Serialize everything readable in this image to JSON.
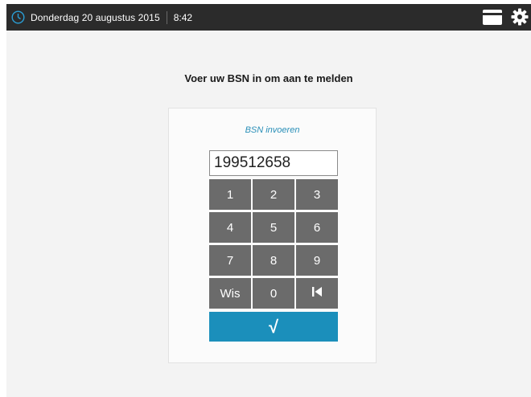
{
  "topbar": {
    "date": "Donderdag 20 augustus 2015",
    "time": "8:42",
    "icons": [
      "clock-icon",
      "card-icon",
      "gear-icon"
    ]
  },
  "prompt": "Voer uw BSN in om aan te melden",
  "panel": {
    "title": "BSN invoeren",
    "bsn_value": "199512658"
  },
  "keypad": {
    "keys": [
      "1",
      "2",
      "3",
      "4",
      "5",
      "6",
      "7",
      "8",
      "9",
      "Wis",
      "0"
    ],
    "backspace_icon": "backspace-icon",
    "confirm_symbol": "√"
  },
  "colors": {
    "topbar_bg": "#2b2b2b",
    "accent": "#1b8fbb",
    "title_text": "#2a8fb8",
    "key_bg": "#6b6b6b",
    "screen_bg": "#f3f3f3"
  }
}
